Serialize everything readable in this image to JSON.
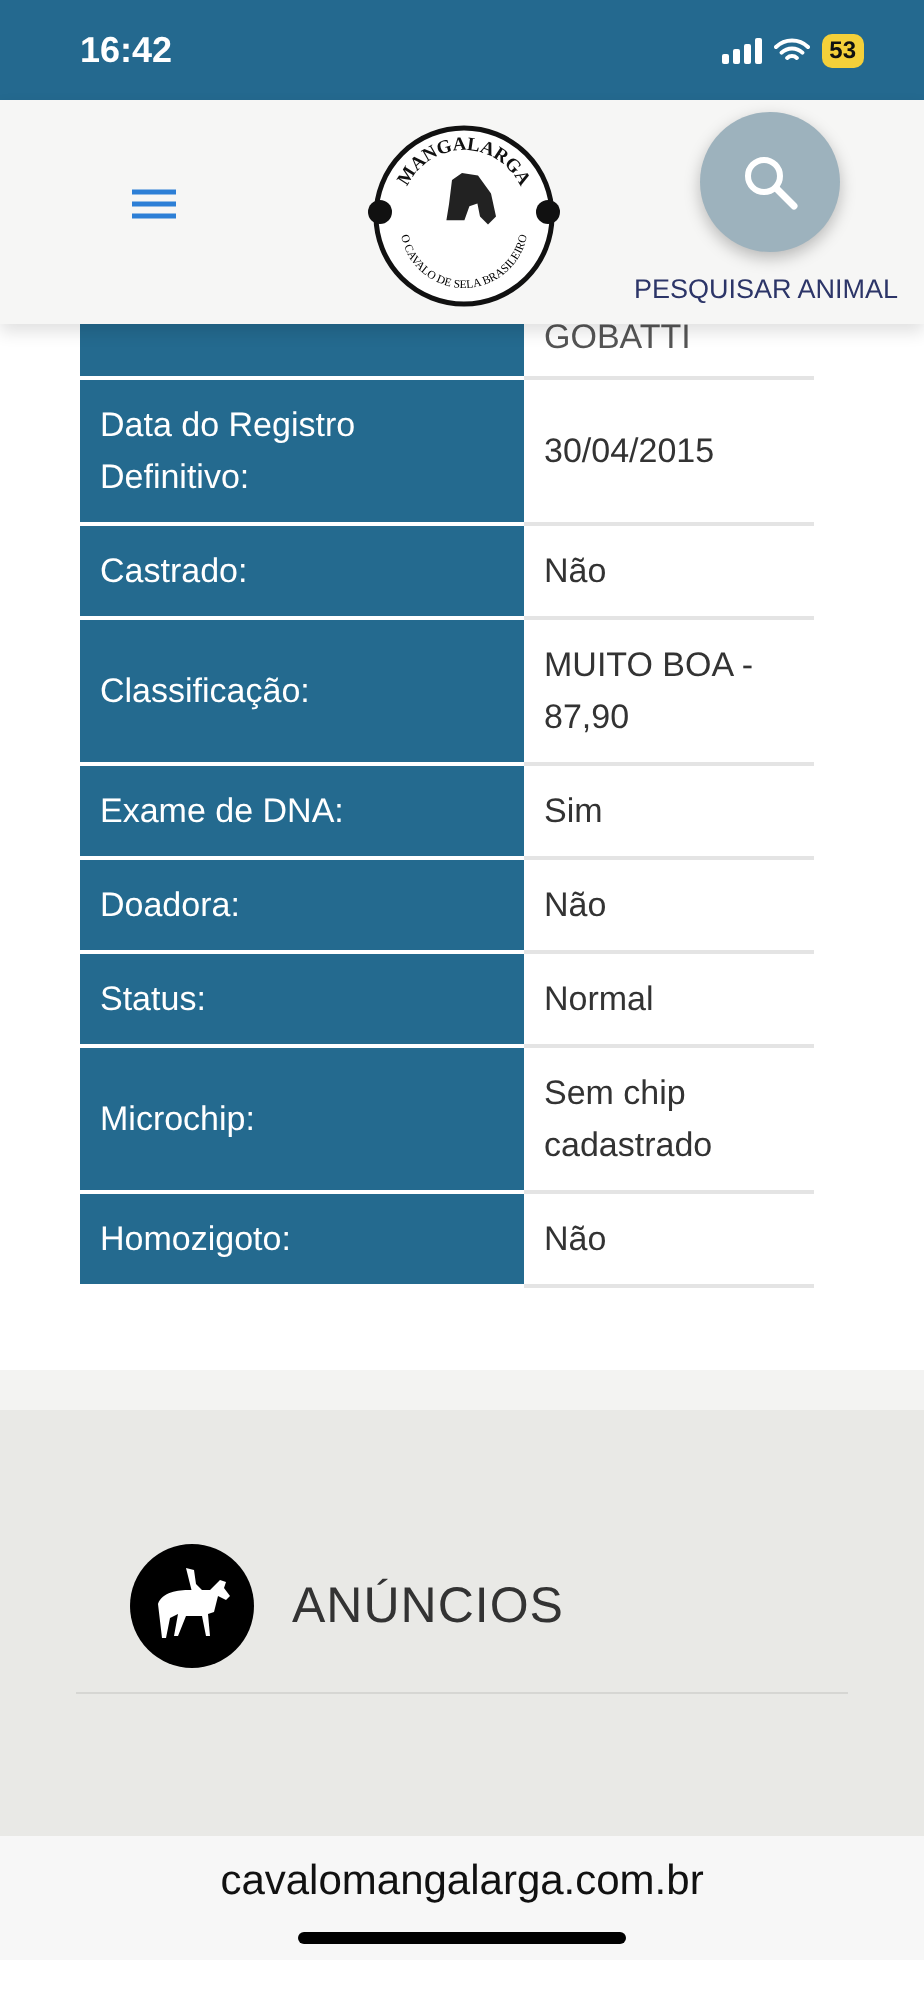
{
  "status_bar": {
    "time": "16:42",
    "battery": "53"
  },
  "header": {
    "logo": {
      "top_text": "MANGALARGA",
      "bottom_text": "O CAVALO DE SELA BRASILEIRO"
    },
    "search_label": "PESQUISAR ANIMAL"
  },
  "details": {
    "partial_value": "GOBATTI",
    "rows": [
      {
        "label": "Data do Registro Definitivo:",
        "value": "30/04/2015"
      },
      {
        "label": "Castrado:",
        "value": "Não"
      },
      {
        "label": "Classificação:",
        "value": "MUITO BOA - 87,90"
      },
      {
        "label": "Exame de DNA:",
        "value": "Sim"
      },
      {
        "label": "Doadora:",
        "value": "Não"
      },
      {
        "label": "Status:",
        "value": "Normal"
      },
      {
        "label": "Microchip:",
        "value": "Sem chip cadastrado"
      },
      {
        "label": "Homozigoto:",
        "value": "Não"
      }
    ]
  },
  "ads": {
    "title": "ANÚNCIOS"
  },
  "browser": {
    "url": "cavalomangalarga.com.br"
  }
}
